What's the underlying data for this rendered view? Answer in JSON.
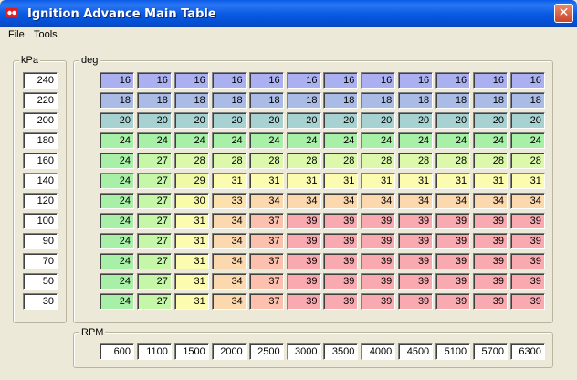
{
  "window": {
    "title": "Ignition Advance Main Table",
    "close_glyph": "✕"
  },
  "menu": [
    {
      "label": "File"
    },
    {
      "label": "Tools"
    }
  ],
  "kpa": {
    "label": "kPa",
    "values": [
      "240",
      "220",
      "200",
      "180",
      "160",
      "140",
      "120",
      "100",
      "90",
      "70",
      "50",
      "30"
    ]
  },
  "deg": {
    "label": "deg",
    "rows": [
      [
        "16",
        "16",
        "16",
        "16",
        "16",
        "16",
        "16",
        "16",
        "16",
        "16",
        "16",
        "16"
      ],
      [
        "18",
        "18",
        "18",
        "18",
        "18",
        "18",
        "18",
        "18",
        "18",
        "18",
        "18",
        "18"
      ],
      [
        "20",
        "20",
        "20",
        "20",
        "20",
        "20",
        "20",
        "20",
        "20",
        "20",
        "20",
        "20"
      ],
      [
        "24",
        "24",
        "24",
        "24",
        "24",
        "24",
        "24",
        "24",
        "24",
        "24",
        "24",
        "24"
      ],
      [
        "24",
        "27",
        "28",
        "28",
        "28",
        "28",
        "28",
        "28",
        "28",
        "28",
        "28",
        "28"
      ],
      [
        "24",
        "27",
        "29",
        "31",
        "31",
        "31",
        "31",
        "31",
        "31",
        "31",
        "31",
        "31"
      ],
      [
        "24",
        "27",
        "30",
        "33",
        "34",
        "34",
        "34",
        "34",
        "34",
        "34",
        "34",
        "34"
      ],
      [
        "24",
        "27",
        "31",
        "34",
        "37",
        "39",
        "39",
        "39",
        "39",
        "39",
        "39",
        "39"
      ],
      [
        "24",
        "27",
        "31",
        "34",
        "37",
        "39",
        "39",
        "39",
        "39",
        "39",
        "39",
        "39"
      ],
      [
        "24",
        "27",
        "31",
        "34",
        "37",
        "39",
        "39",
        "39",
        "39",
        "39",
        "39",
        "39"
      ],
      [
        "24",
        "27",
        "31",
        "34",
        "37",
        "39",
        "39",
        "39",
        "39",
        "39",
        "39",
        "39"
      ],
      [
        "24",
        "27",
        "31",
        "34",
        "37",
        "39",
        "39",
        "39",
        "39",
        "39",
        "39",
        "39"
      ]
    ]
  },
  "rpm": {
    "label": "RPM",
    "values": [
      "600",
      "1100",
      "1500",
      "2000",
      "2500",
      "3000",
      "3500",
      "4000",
      "4500",
      "5100",
      "5700",
      "6300"
    ]
  },
  "colors": {
    "16": "#aab0f0",
    "18": "#aabce6",
    "20": "#a8d2d2",
    "24": "#a8f0a8",
    "27": "#c6f6a8",
    "28": "#dcf8aa",
    "29": "#eefaa8",
    "30": "#f8fcaa",
    "31": "#fcfcb0",
    "33": "#fce0ae",
    "34": "#fcd8ae",
    "37": "#fcc0ae",
    "39": "#f8aab0"
  }
}
